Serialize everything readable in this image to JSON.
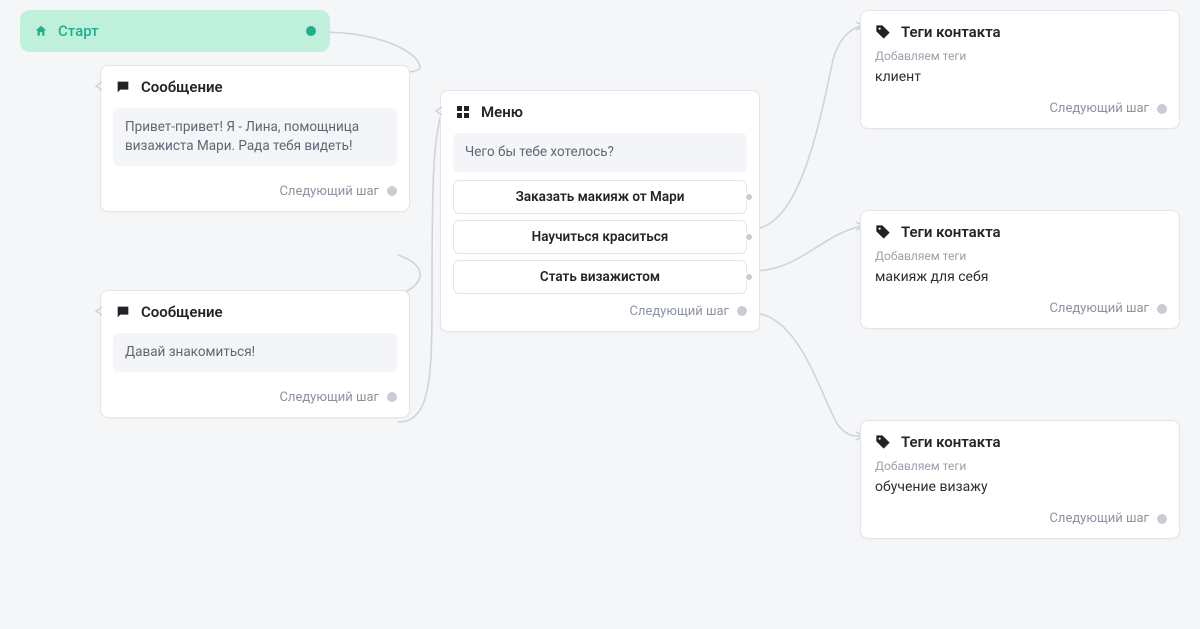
{
  "start": {
    "label": "Старт"
  },
  "nextStepLabel": "Следующий шаг",
  "addTagsLabel": "Добавляем теги",
  "messages": {
    "title": "Сообщение",
    "m1": "Привет-привет! Я - Лина, помощница визажиста Мари. Рада тебя видеть!",
    "m2": "Давай знакомиться!"
  },
  "menu": {
    "title": "Меню",
    "prompt": "Чего бы тебе хотелось?",
    "options": {
      "o1": "Заказать макияж от Мари",
      "o2": "Научиться краситься",
      "o3": "Стать визажистом"
    }
  },
  "tags": {
    "title": "Теги контакта",
    "t1": "клиент",
    "t2": "макияж для себя",
    "t3": "обучение визажу"
  }
}
